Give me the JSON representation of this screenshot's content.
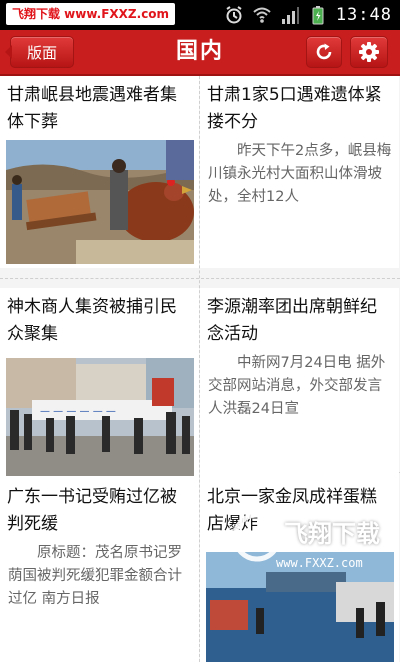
{
  "watermark": {
    "site_badge": "飞翔下载 www.FXXZ.com",
    "corner_title": "飞翔下载",
    "corner_url": "www.FXXZ.com"
  },
  "status_bar": {
    "time": "13:48"
  },
  "header": {
    "edition_label": "版面",
    "title": "国内"
  },
  "articles": [
    {
      "headline": "甘肃岷县地震遇难者集体下葬",
      "summary": "",
      "has_image": true
    },
    {
      "headline": "甘肃1家5口遇难遗体紧搂不分",
      "summary": "昨天下午2点多，岷县梅川镇永光村大面积山体滑坡处，全村12人",
      "has_image": false
    },
    {
      "headline": "神木商人集资被捕引民众聚集",
      "summary": "",
      "has_image": true
    },
    {
      "headline": "李源潮率团出席朝鲜纪念活动",
      "summary": "中新网7月24日电 据外交部网站消息，外交部发言人洪磊24日宣",
      "has_image": false
    },
    {
      "headline": "广东一书记受贿过亿被判死缓",
      "summary": "原标题：茂名原书记罗荫国被判死缓犯罪金额合计过亿 南方日报",
      "has_image": false
    },
    {
      "headline": "北京一家金凤成祥蛋糕店爆炸",
      "summary": "",
      "has_image": true
    }
  ],
  "colors": {
    "header_red": "#c81e1e",
    "status_black": "#000000"
  }
}
